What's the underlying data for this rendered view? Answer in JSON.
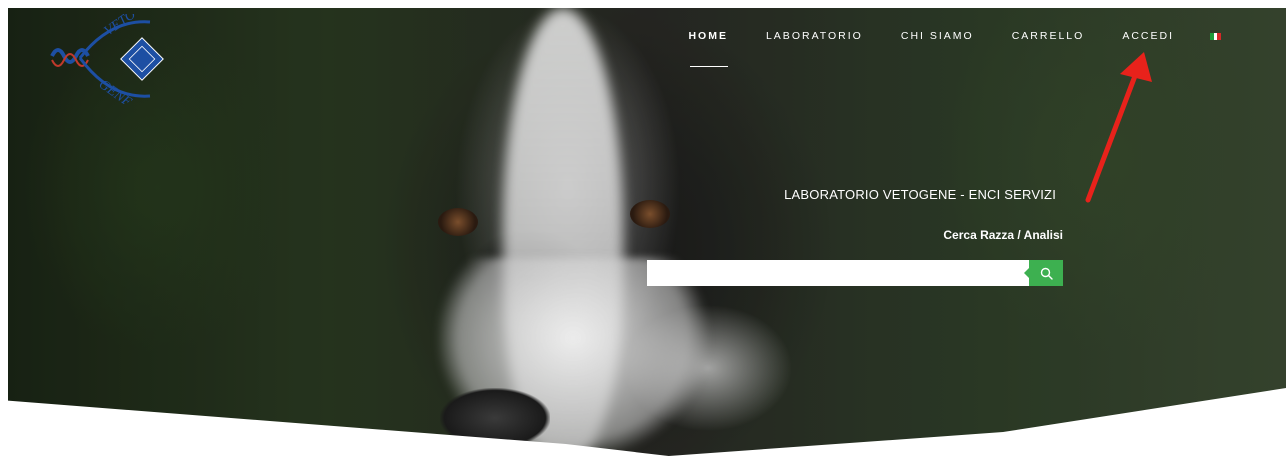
{
  "brand": {
    "logo_alt": "VETOGENE laboratorio",
    "colors": {
      "logo": "#1d4fa3",
      "accent": "#3db050",
      "arrow": "#e8221b"
    }
  },
  "nav": {
    "items": [
      {
        "label": "HOME",
        "active": true
      },
      {
        "label": "LABORATORIO",
        "active": false
      },
      {
        "label": "CHI SIAMO",
        "active": false
      },
      {
        "label": "CARRELLO",
        "active": false
      },
      {
        "label": "ACCEDI",
        "active": false
      }
    ],
    "language_icon": "italian-flag-icon"
  },
  "hero": {
    "tagline": "LABORATORIO VETOGENE - ENCI SERVIZI",
    "search_label": "Cerca Razza / Analisi",
    "search_placeholder": "",
    "search_icon": "search-icon"
  }
}
